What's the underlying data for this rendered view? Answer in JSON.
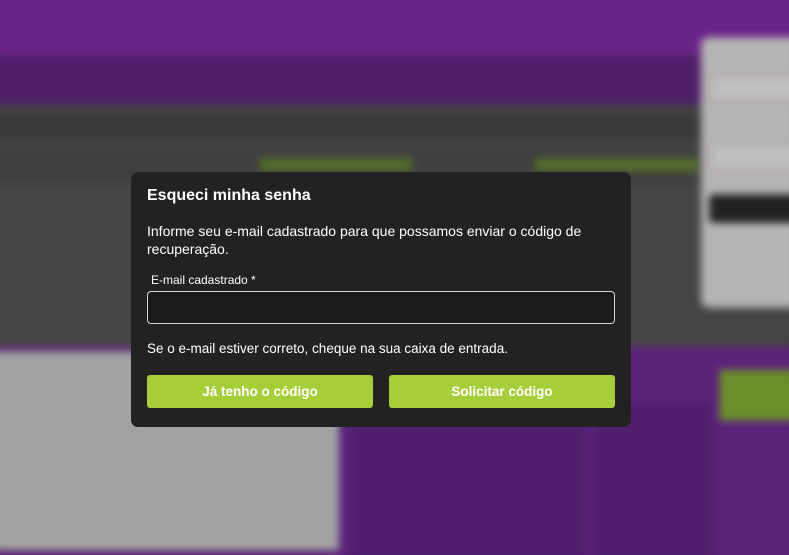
{
  "modal": {
    "title": "Esqueci minha senha",
    "description": "Informe seu e-mail cadastrado para que possamos enviar o código de recuperação.",
    "email_label": "E-mail cadastrado *",
    "email_value": "",
    "hint": "Se o e-mail estiver correto, cheque na sua caixa de entrada.",
    "buttons": {
      "have_code": "Já tenho o código",
      "request_code": "Solicitar código"
    }
  },
  "colors": {
    "modal_bg": "#222222",
    "accent_green": "#a6ce39",
    "background_purple": "#8e2fb5"
  }
}
